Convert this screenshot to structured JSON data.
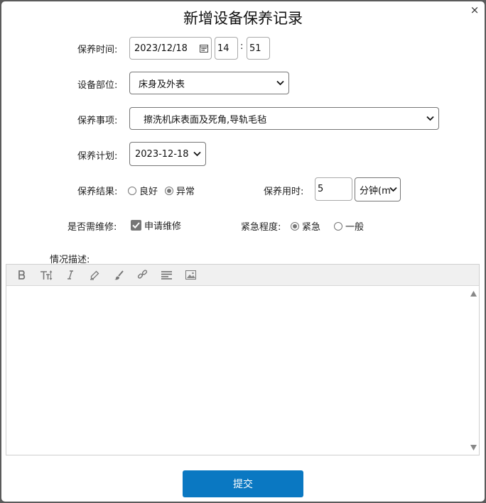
{
  "dialog": {
    "title": "新增设备保养记录",
    "close_glyph": "×"
  },
  "form": {
    "time": {
      "label": "保养时间:",
      "date": "2023/12/18",
      "hour": "14",
      "separator": ":",
      "minute": "51"
    },
    "part": {
      "label": "设备部位:",
      "selected": "床身及外表"
    },
    "item": {
      "label": "保养事项:",
      "selected": "擦洗机床表面及死角,导轨毛毡"
    },
    "plan": {
      "label": "保养计划:",
      "selected": "2023-12-18"
    },
    "result": {
      "label": "保养结果:",
      "options": [
        "良好",
        "异常"
      ],
      "selected": "异常"
    },
    "duration": {
      "label": "保养用时:",
      "value": "5",
      "unit": "分钟(m"
    },
    "repair": {
      "label": "是否需维修:",
      "checkbox_label": "申请维修",
      "checked": true
    },
    "urgency": {
      "label": "紧急程度:",
      "options": [
        "紧急",
        "一般"
      ],
      "selected": "紧急"
    },
    "description": {
      "label": "情况描述:",
      "value": ""
    }
  },
  "editor_toolbar": {
    "icons": [
      "bold-icon",
      "text-size-icon",
      "italic-icon",
      "marker-icon",
      "brush-icon",
      "link-icon",
      "align-icon",
      "image-icon"
    ]
  },
  "submit": {
    "label": "提交"
  },
  "colors": {
    "accent": "#0a78c2",
    "border": "#a9a9a9",
    "toolbar_bg": "#f0f0f0",
    "backdrop": "#5b5b5b"
  }
}
